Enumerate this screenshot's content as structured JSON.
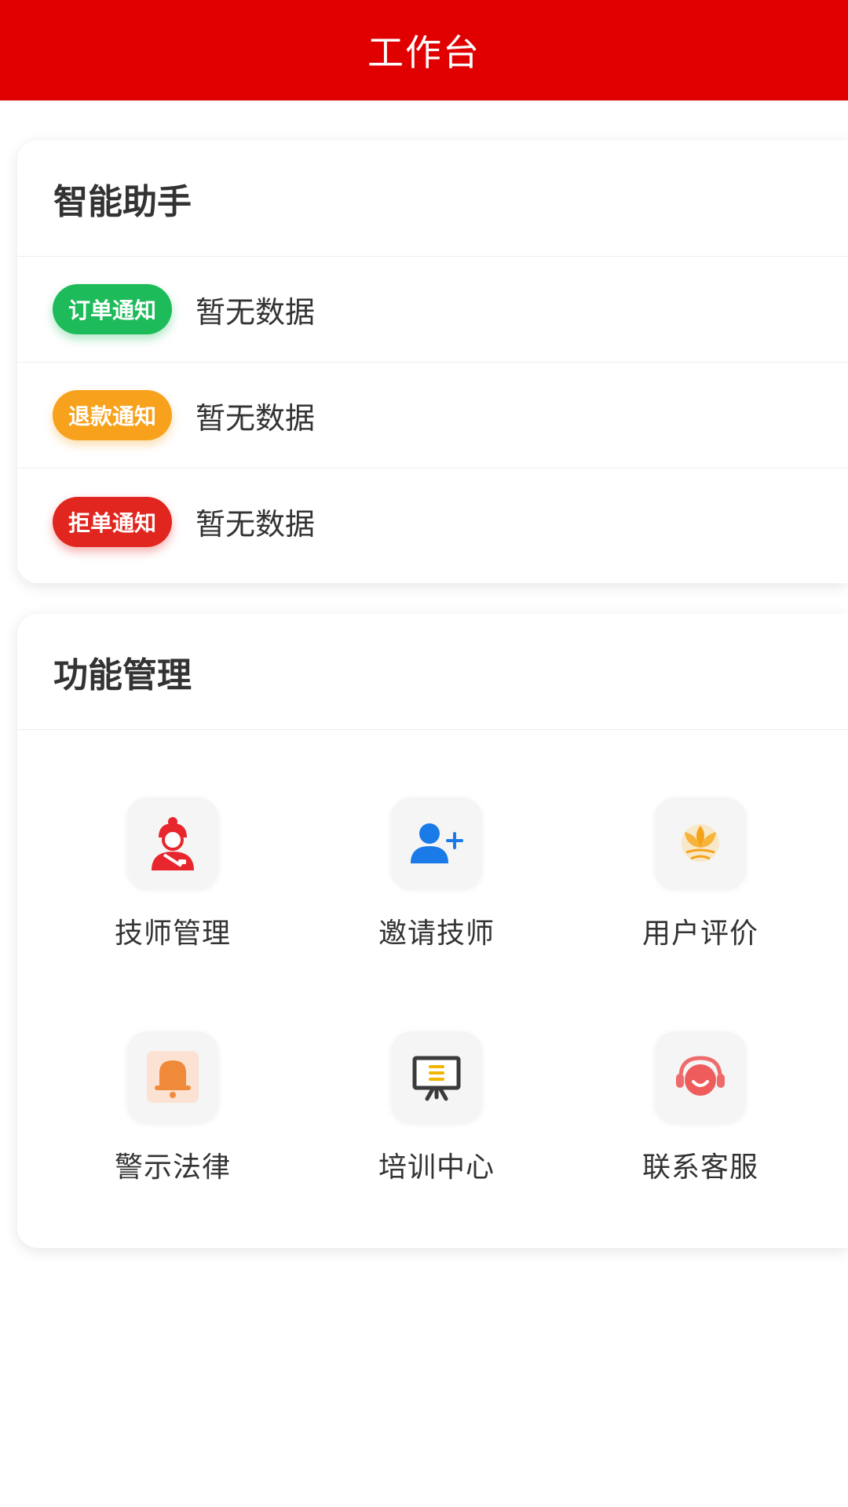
{
  "header": {
    "title": "工作台"
  },
  "assistant": {
    "title": "智能助手",
    "notices": [
      {
        "tag": "订单通知",
        "text": "暂无数据",
        "color": "#1dbb5a"
      },
      {
        "tag": "退款通知",
        "text": "暂无数据",
        "color": "#f7a11c"
      },
      {
        "tag": "拒单通知",
        "text": "暂无数据",
        "color": "#e0261f"
      }
    ]
  },
  "functions": {
    "title": "功能管理",
    "items": [
      {
        "label": "技师管理",
        "icon": "technician-icon"
      },
      {
        "label": "邀请技师",
        "icon": "add-user-icon"
      },
      {
        "label": "用户评价",
        "icon": "lotus-icon"
      },
      {
        "label": "警示法律",
        "icon": "bell-icon"
      },
      {
        "label": "培训中心",
        "icon": "presentation-board-icon"
      },
      {
        "label": "联系客服",
        "icon": "headset-icon"
      }
    ]
  },
  "colors": {
    "brand": "#e00000"
  }
}
